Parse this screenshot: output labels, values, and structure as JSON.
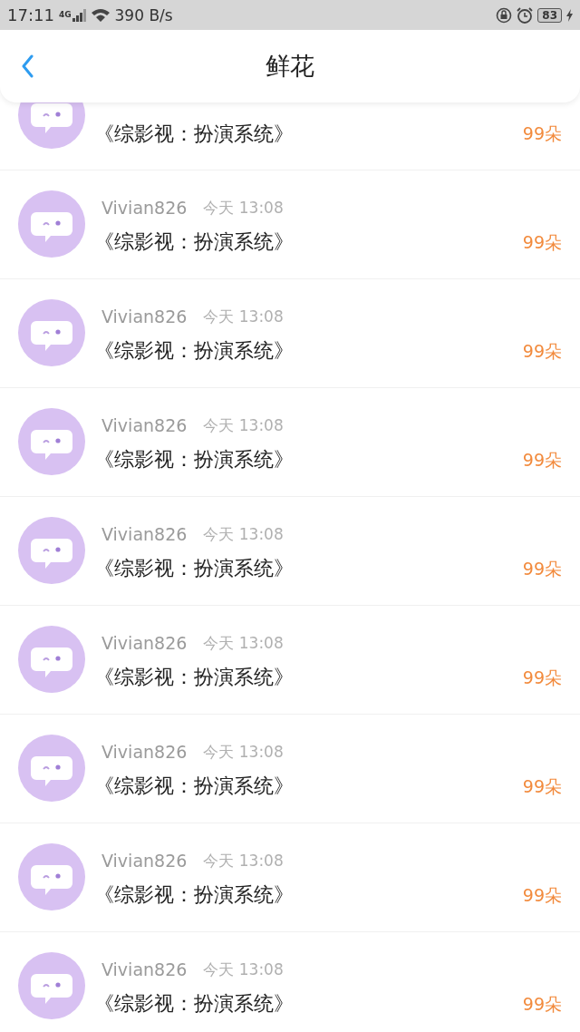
{
  "status_bar": {
    "time": "17:11",
    "network": "4G",
    "speed": "390 B/s",
    "battery": "83"
  },
  "header": {
    "title": "鲜花"
  },
  "rows": [
    {
      "title": "《综影视：扮演系统》",
      "amount": "99朵"
    },
    {
      "user": "Vivian826",
      "time": "今天 13:08",
      "title": "《综影视：扮演系统》",
      "amount": "99朵"
    },
    {
      "user": "Vivian826",
      "time": "今天 13:08",
      "title": "《综影视：扮演系统》",
      "amount": "99朵"
    },
    {
      "user": "Vivian826",
      "time": "今天 13:08",
      "title": "《综影视：扮演系统》",
      "amount": "99朵"
    },
    {
      "user": "Vivian826",
      "time": "今天 13:08",
      "title": "《综影视：扮演系统》",
      "amount": "99朵"
    },
    {
      "user": "Vivian826",
      "time": "今天 13:08",
      "title": "《综影视：扮演系统》",
      "amount": "99朵"
    },
    {
      "user": "Vivian826",
      "time": "今天 13:08",
      "title": "《综影视：扮演系统》",
      "amount": "99朵"
    },
    {
      "user": "Vivian826",
      "time": "今天 13:08",
      "title": "《综影视：扮演系统》",
      "amount": "99朵"
    },
    {
      "user": "Vivian826",
      "time": "今天 13:08",
      "title": "《综影视：扮演系统》",
      "amount": "99朵"
    }
  ]
}
